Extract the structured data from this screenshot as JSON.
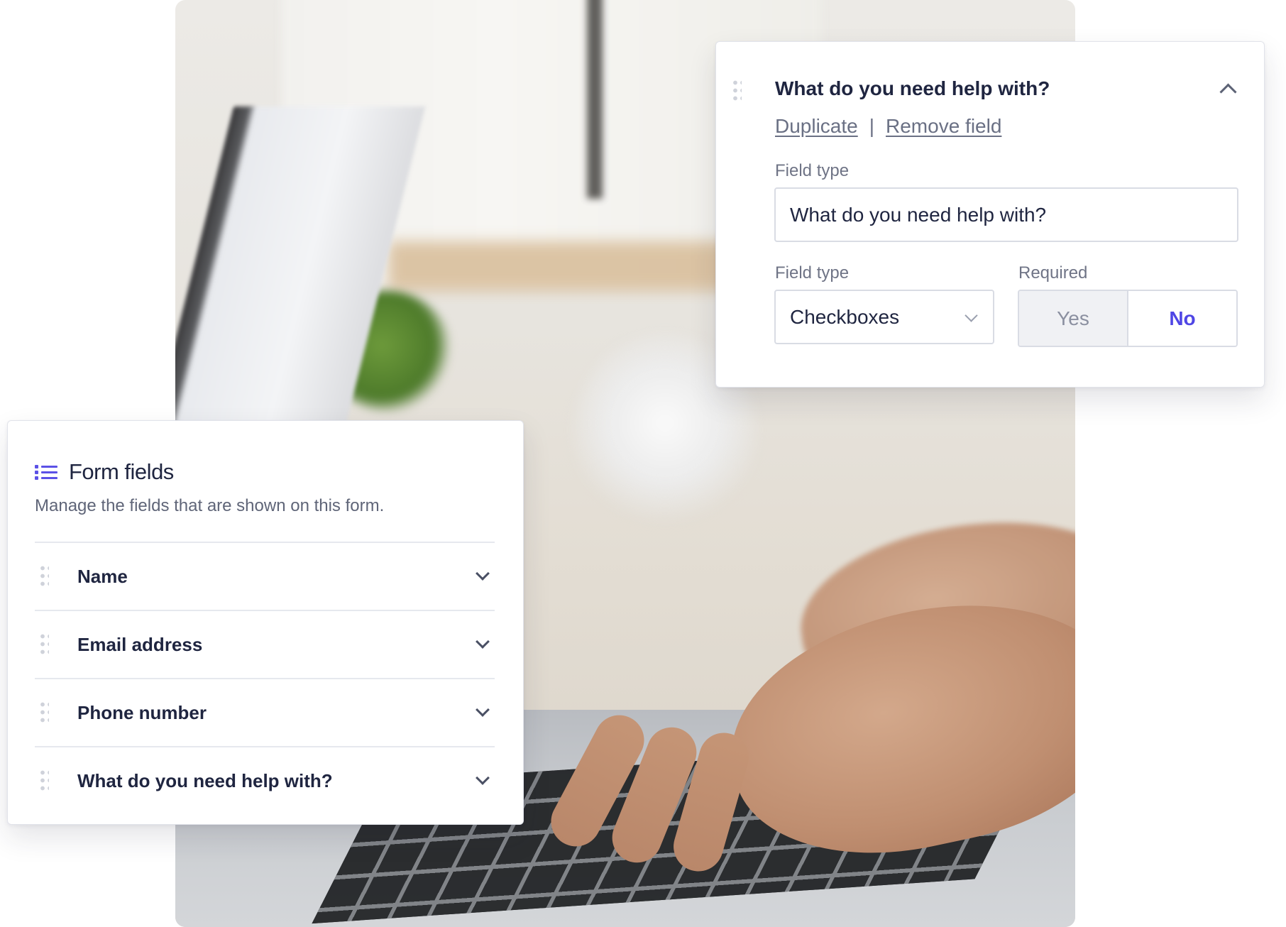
{
  "editor": {
    "title": "What do you need help with?",
    "duplicate_label": "Duplicate",
    "separator": "|",
    "remove_label": "Remove field",
    "label_field_label": "Field type",
    "label_value": "What do you need help with?",
    "type_label": "Field type",
    "type_value": "Checkboxes",
    "required_label": "Required",
    "required_yes": "Yes",
    "required_no": "No",
    "required_selected": "No"
  },
  "form_fields": {
    "heading": "Form fields",
    "description": "Manage the fields that are shown on this form.",
    "items": [
      {
        "label": "Name"
      },
      {
        "label": "Email address"
      },
      {
        "label": "Phone number"
      },
      {
        "label": "What do you need help with?"
      }
    ]
  },
  "colors": {
    "accent": "#4f46e5",
    "text": "#1f2540",
    "muted": "#6f7486",
    "border": "#d9dce4"
  },
  "icons": [
    "drag-handle-icon",
    "chevron-up-icon",
    "chevron-down-icon",
    "list-icon"
  ]
}
